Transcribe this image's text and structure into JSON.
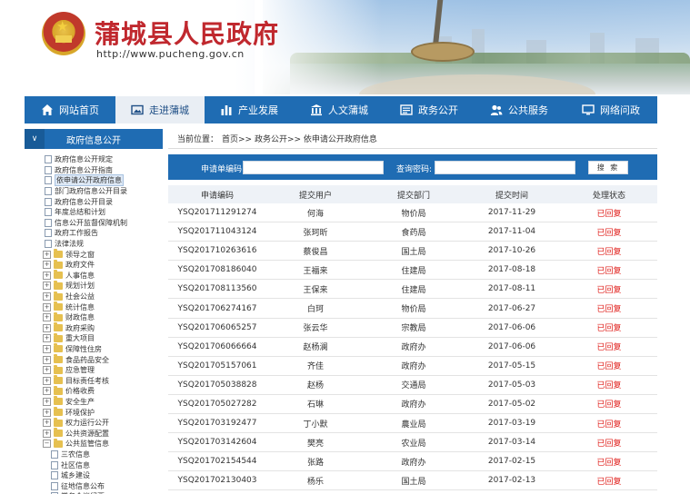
{
  "header": {
    "title": "蒲城县人民政府",
    "url": "http://www.pucheng.gov.cn"
  },
  "nav": {
    "items": [
      {
        "label": "网站首页",
        "icon": "home-icon"
      },
      {
        "label": "走进蒲城",
        "icon": "picture-icon"
      },
      {
        "label": "产业发展",
        "icon": "bar-chart-icon"
      },
      {
        "label": "人文蒲城",
        "icon": "institution-icon"
      },
      {
        "label": "政务公开",
        "icon": "list-icon"
      },
      {
        "label": "公共服务",
        "icon": "users-icon"
      },
      {
        "label": "网络问政",
        "icon": "monitor-icon"
      }
    ],
    "active_index": 1
  },
  "sidebar": {
    "title": "政府信息公开",
    "items": [
      {
        "label": "政府信息公开规定",
        "kind": "doc"
      },
      {
        "label": "政府信息公开指南",
        "kind": "doc"
      },
      {
        "label": "依申请公开政府信息",
        "kind": "doc",
        "selected": true
      },
      {
        "label": "部门政府信息公开目录",
        "kind": "doc"
      },
      {
        "label": "政府信息公开目录",
        "kind": "doc"
      },
      {
        "label": "年度总结和计划",
        "kind": "doc"
      },
      {
        "label": "信息公开监督保障机制",
        "kind": "doc"
      },
      {
        "label": "政府工作报告",
        "kind": "doc"
      },
      {
        "label": "法律法规",
        "kind": "doc"
      },
      {
        "label": "领导之窗",
        "kind": "folder"
      },
      {
        "label": "政府文件",
        "kind": "folder"
      },
      {
        "label": "人事信息",
        "kind": "folder"
      },
      {
        "label": "规划计划",
        "kind": "folder"
      },
      {
        "label": "社会公益",
        "kind": "folder"
      },
      {
        "label": "统计信息",
        "kind": "folder"
      },
      {
        "label": "财政信息",
        "kind": "folder"
      },
      {
        "label": "政府采购",
        "kind": "folder"
      },
      {
        "label": "重大项目",
        "kind": "folder"
      },
      {
        "label": "保障性住房",
        "kind": "folder"
      },
      {
        "label": "食品药品安全",
        "kind": "folder"
      },
      {
        "label": "应急管理",
        "kind": "folder"
      },
      {
        "label": "目标责任考核",
        "kind": "folder"
      },
      {
        "label": "价格收费",
        "kind": "folder"
      },
      {
        "label": "安全生产",
        "kind": "folder"
      },
      {
        "label": "环境保护",
        "kind": "folder"
      },
      {
        "label": "权力运行公开",
        "kind": "folder"
      },
      {
        "label": "公共资源配置",
        "kind": "folder"
      },
      {
        "label": "公共监管信息",
        "kind": "folder-open"
      },
      {
        "label": "三农信息",
        "kind": "child"
      },
      {
        "label": "社区信息",
        "kind": "child"
      },
      {
        "label": "城乡建设",
        "kind": "child"
      },
      {
        "label": "征地信息公布",
        "kind": "child"
      },
      {
        "label": "常务会议纪要",
        "kind": "child"
      }
    ]
  },
  "breadcrumb": {
    "prefix": "当前位置：",
    "path": "首页>> 政务公开>> 依申请公开政府信息"
  },
  "search": {
    "label1": "申请单编码:",
    "label2": "查询密码:",
    "button": "搜 索"
  },
  "table": {
    "headers": [
      "申请编码",
      "提交用户",
      "提交部门",
      "提交时间",
      "处理状态"
    ],
    "rows": [
      [
        "YSQ201711291274",
        "何海",
        "物价局",
        "2017-11-29",
        "已回复"
      ],
      [
        "YSQ201711043124",
        "张珂昕",
        "食药局",
        "2017-11-04",
        "已回复"
      ],
      [
        "YSQ201710263616",
        "蔡俊昌",
        "国土局",
        "2017-10-26",
        "已回复"
      ],
      [
        "YSQ201708186040",
        "王福来",
        "住建局",
        "2017-08-18",
        "已回复"
      ],
      [
        "YSQ201708113560",
        "王保来",
        "住建局",
        "2017-08-11",
        "已回复"
      ],
      [
        "YSQ201706274167",
        "白珂",
        "物价局",
        "2017-06-27",
        "已回复"
      ],
      [
        "YSQ201706065257",
        "张云华",
        "宗教局",
        "2017-06-06",
        "已回复"
      ],
      [
        "YSQ201706066664",
        "赵杨澜",
        "政府办",
        "2017-06-06",
        "已回复"
      ],
      [
        "YSQ201705157061",
        "齐佳",
        "政府办",
        "2017-05-15",
        "已回复"
      ],
      [
        "YSQ201705038828",
        "赵杨",
        "交通局",
        "2017-05-03",
        "已回复"
      ],
      [
        "YSQ201705027282",
        "石琳",
        "政府办",
        "2017-05-02",
        "已回复"
      ],
      [
        "YSQ201703192477",
        "丁小默",
        "農业局",
        "2017-03-19",
        "已回复"
      ],
      [
        "YSQ201703142604",
        "樊亮",
        "农业局",
        "2017-03-14",
        "已回复"
      ],
      [
        "YSQ201702154544",
        "张路",
        "政府办",
        "2017-02-15",
        "已回复"
      ],
      [
        "YSQ201702130403",
        "杨乐",
        "国土局",
        "2017-02-13",
        "已回复"
      ]
    ]
  },
  "colors": {
    "nav_blue": "#1f6cb3",
    "title_red": "#c0282e",
    "status_red": "#e0201c"
  }
}
